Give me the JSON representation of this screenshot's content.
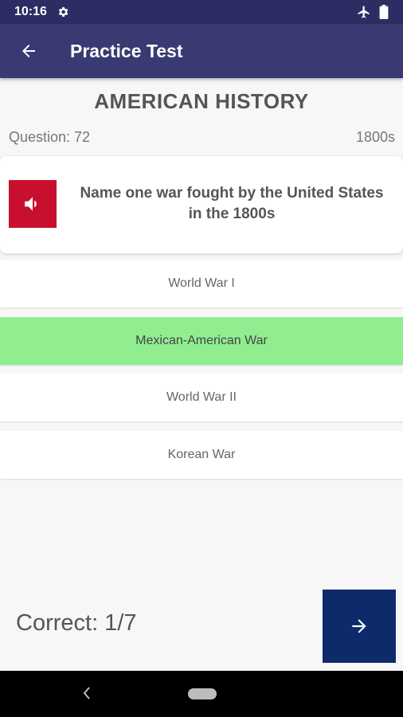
{
  "status": {
    "time": "10:16",
    "icons": [
      "gear-icon",
      "airplane-icon",
      "battery-icon"
    ]
  },
  "app_bar": {
    "title": "Practice Test",
    "back_icon": "arrow-left-icon"
  },
  "quiz": {
    "subject": "AMERICAN HISTORY",
    "question_label": "Question: 72",
    "category": "1800s",
    "question": "Name one war fought by the United States in the 1800s",
    "options": [
      "World War I",
      "Mexican-American War",
      "World War II",
      "Korean War"
    ],
    "correct_option_index": 1
  },
  "footer": {
    "score": "Correct: 1/7",
    "next_icon": "arrow-right-icon"
  },
  "colors": {
    "app_bar": "#3a3a72",
    "status_bar": "#2b2d63",
    "audio_button": "#c8102e",
    "correct": "#90ee90",
    "next_button": "#0f2a6b"
  }
}
